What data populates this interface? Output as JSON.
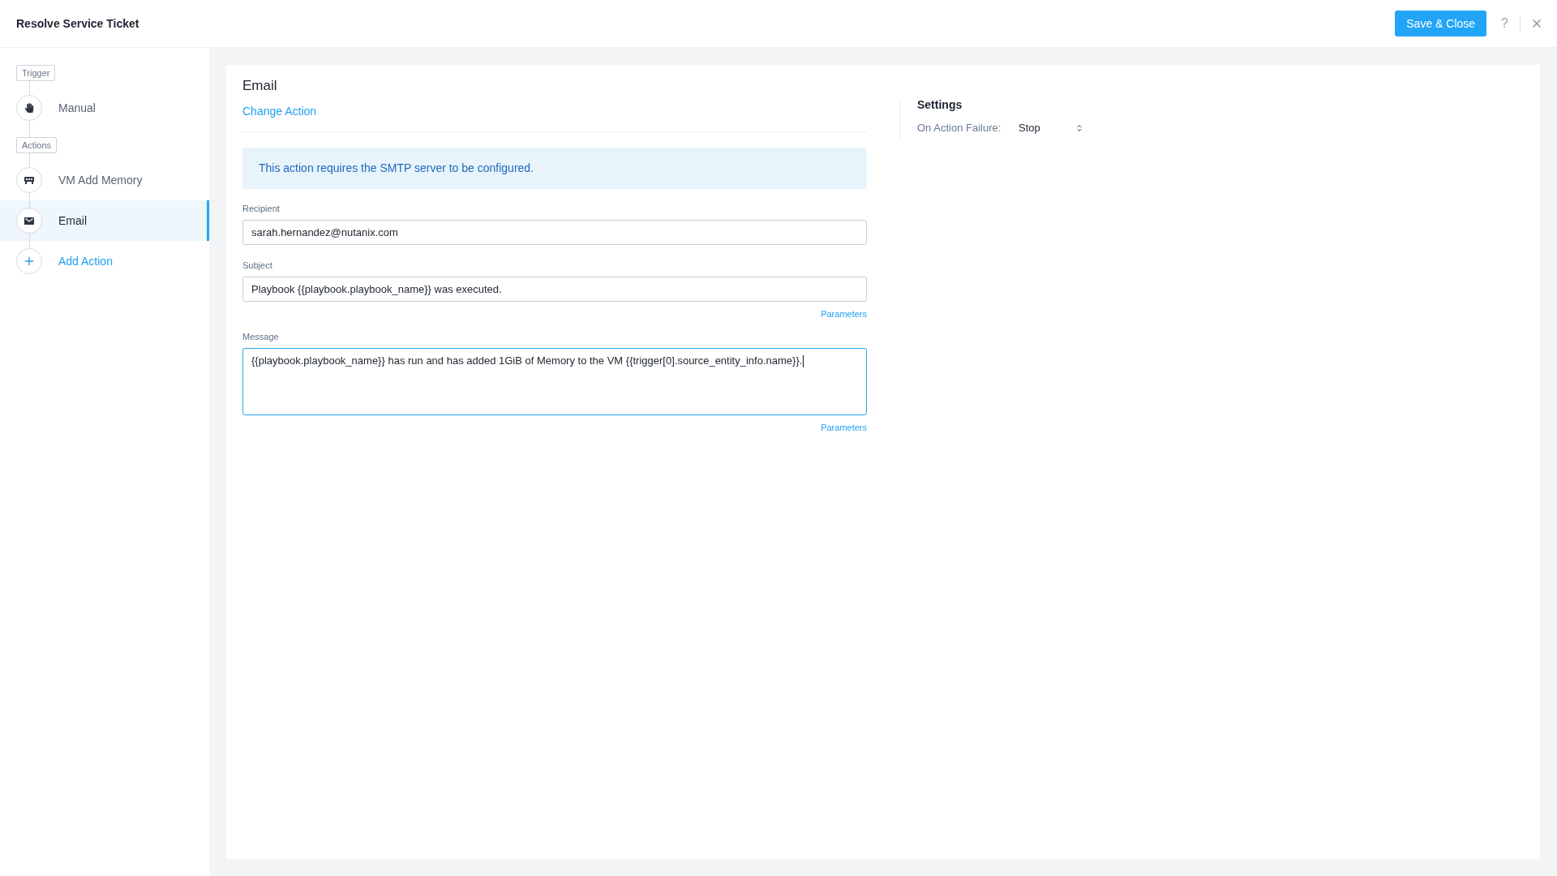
{
  "window": {
    "title": "Resolve Service Ticket"
  },
  "header": {
    "save_button": "Save & Close",
    "help": "?"
  },
  "sidebar": {
    "sections": [
      {
        "tag": "Trigger",
        "items": [
          {
            "label": "Manual",
            "kind": "manual",
            "selected": false
          }
        ]
      },
      {
        "tag": "Actions",
        "items": [
          {
            "label": "VM Add Memory",
            "kind": "vm_memory",
            "selected": false
          },
          {
            "label": "Email",
            "kind": "email",
            "selected": true
          }
        ]
      }
    ],
    "add_action": "Add Action"
  },
  "action": {
    "title": "Email",
    "change_action": "Change Action",
    "notice": "This action requires the SMTP server to be configured.",
    "fields": [
      {
        "label": "Recipient",
        "kind": "input",
        "value": "sarah.hernandez@nutanix.com",
        "focused": false
      },
      {
        "label": "Subject",
        "kind": "input",
        "value": "Playbook {{playbook.playbook_name}} was executed.",
        "focused": false,
        "link": "Parameters"
      },
      {
        "label": "Message",
        "kind": "textarea",
        "value": "{{playbook.playbook_name}} has run and has added 1GiB of Memory to the VM {{trigger[0].source_entity_info.name}}.",
        "focused": true,
        "link": "Parameters"
      }
    ]
  },
  "settings": {
    "title": "Settings",
    "on_failure": {
      "label": "On Action Failure:",
      "value": "Stop"
    }
  }
}
